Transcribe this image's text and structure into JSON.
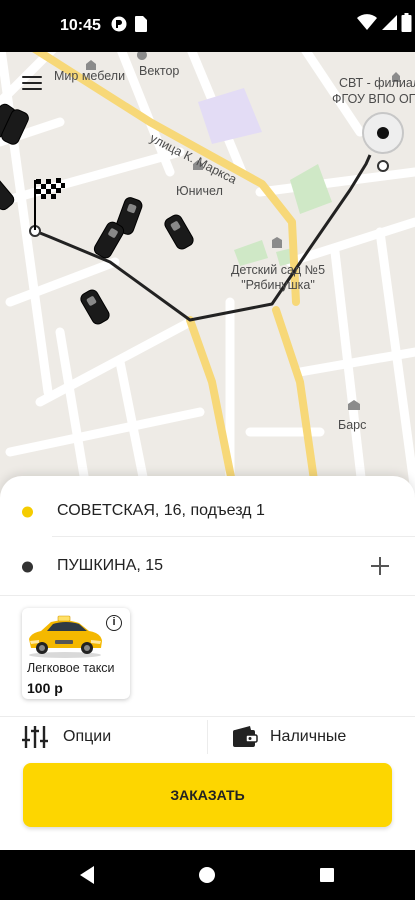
{
  "status_bar": {
    "time": "10:45"
  },
  "map": {
    "labels": {
      "furniture_world": "Мир мебели",
      "vektor": "Вектор",
      "street_marx": "улица К. Маркса",
      "yunichel": "Юничел",
      "branch_line1": "СВТ - филиал",
      "branch_line2": "ФГОУ ВПО ОГ",
      "kindergarten_line1": "Детский сад №5",
      "kindergarten_line2": "\"Рябинушка\"",
      "bars": "Барс"
    }
  },
  "route": {
    "pickup": "СОВЕТСКАЯ, 16, подъезд 1",
    "destination": "ПУШКИНА, 15"
  },
  "tariff": {
    "name": "Легковое такси",
    "price": "100 р"
  },
  "options": {
    "options_label": "Опции",
    "payment_label": "Наличные"
  },
  "order_button": {
    "label": "ЗАКАЗАТЬ"
  },
  "colors": {
    "accent": "#fdd600",
    "pickup_dot": "#f5cc00",
    "destination_dot": "#333333",
    "route_line": "#222222",
    "map_background": "#eeebe6",
    "major_road": "#f7d878"
  }
}
